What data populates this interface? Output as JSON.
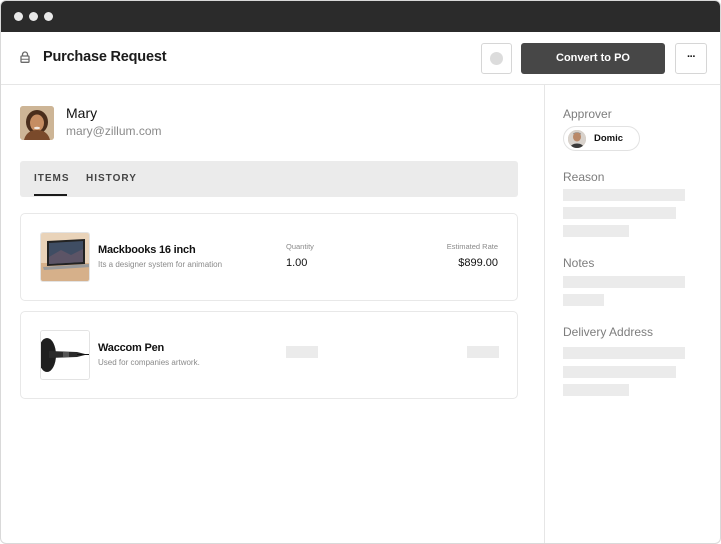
{
  "header": {
    "title": "Purchase Request",
    "convert_label": "Convert to PO",
    "more_label": "···"
  },
  "user": {
    "name": "Mary",
    "email": "mary@zillum.com"
  },
  "tabs": [
    {
      "label": "ITEMS",
      "active": true
    },
    {
      "label": "HISTORY",
      "active": false
    }
  ],
  "items": [
    {
      "name": "Mackbooks 16 inch",
      "description": "Its a designer system for animation",
      "quantity_label": "Quantity",
      "quantity": "1.00",
      "rate_label": "Estimated Rate",
      "rate": "$899.00"
    },
    {
      "name": "Waccom Pen",
      "description": "Used for companies artwork."
    }
  ],
  "sidebar": {
    "approver_label": "Approver",
    "approver_name": "Domic",
    "reason_label": "Reason",
    "notes_label": "Notes",
    "delivery_label": "Delivery Address"
  },
  "colors": {
    "titlebar": "#2b2b2b",
    "primary_button": "#474747",
    "placeholder": "#ebebeb"
  }
}
